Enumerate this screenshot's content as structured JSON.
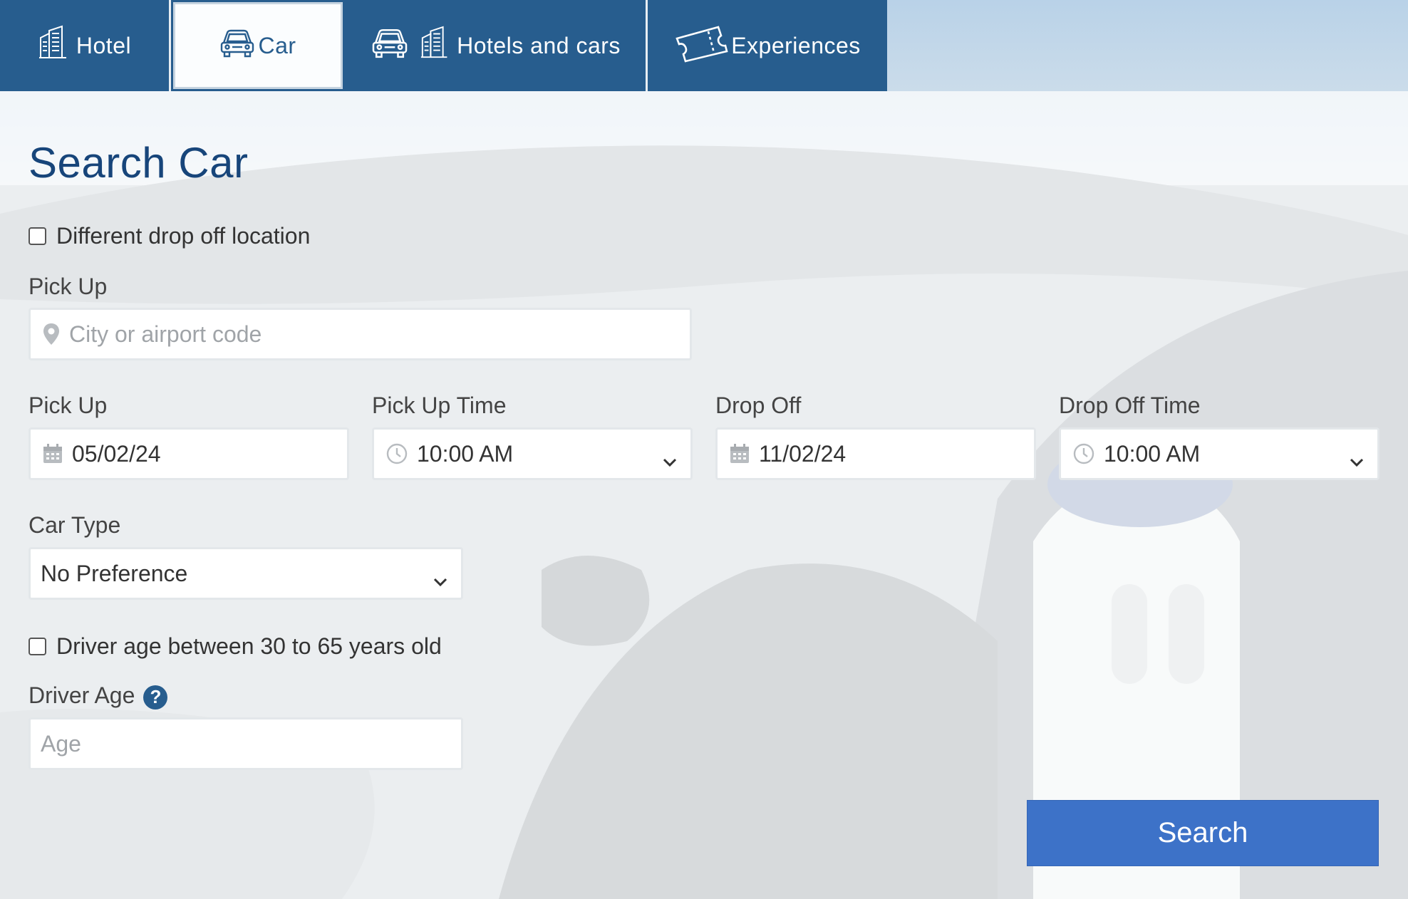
{
  "tabs": [
    {
      "label": "Hotel",
      "icon": "hotel-icon"
    },
    {
      "label": "Car",
      "icon": "car-icon",
      "active": true
    },
    {
      "label": "Hotels and cars",
      "icon": "car-icon"
    },
    {
      "label": "Experiences",
      "icon": "ticket-icon"
    }
  ],
  "form": {
    "title": "Search Car",
    "different_dropoff_label": "Different drop off location",
    "pickup_location_label": "Pick Up",
    "pickup_location_placeholder": "City or airport code",
    "pickup_date_label": "Pick Up",
    "pickup_date_value": "05/02/24",
    "pickup_time_label": "Pick Up Time",
    "pickup_time_value": "10:00 AM",
    "dropoff_date_label": "Drop Off",
    "dropoff_date_value": "11/02/24",
    "dropoff_time_label": "Drop Off Time",
    "dropoff_time_value": "10:00 AM",
    "car_type_label": "Car Type",
    "car_type_value": "No Preference",
    "driver_age_check_label": "Driver age between 30 to 65 years old",
    "driver_age_label": "Driver Age",
    "driver_age_help": "?",
    "driver_age_placeholder": "Age",
    "search_label": "Search"
  },
  "colors": {
    "brand": "#275d8e",
    "title": "#17457a",
    "button": "#3d72c8"
  }
}
